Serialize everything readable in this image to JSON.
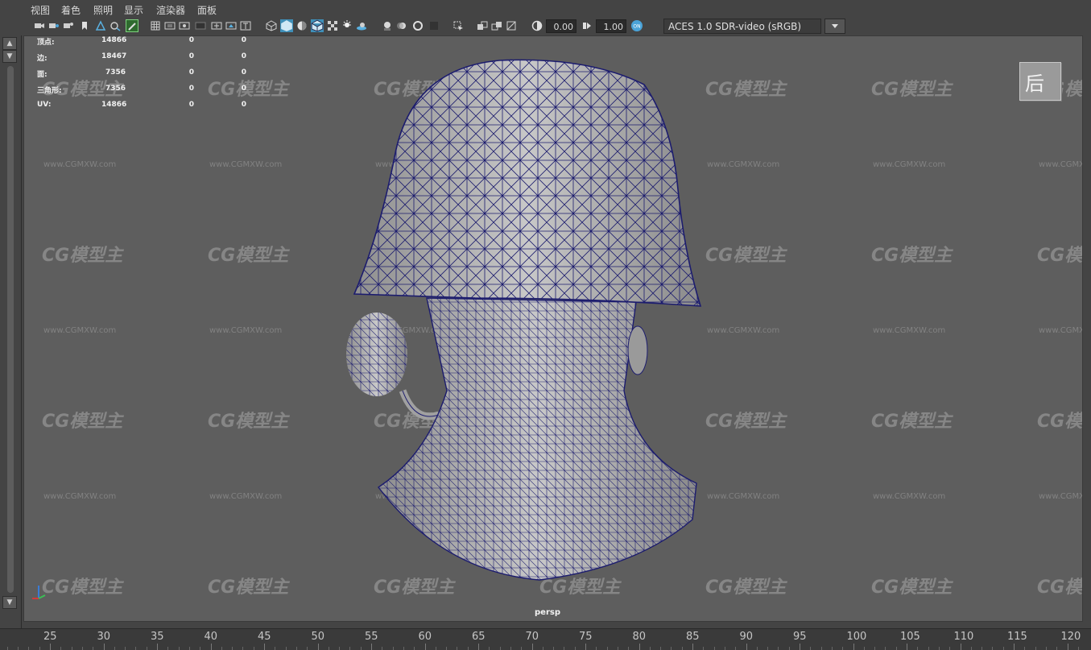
{
  "menu": [
    {
      "label": "视图"
    },
    {
      "label": "着色"
    },
    {
      "label": "照明"
    },
    {
      "label": "显示"
    },
    {
      "label": "渲染器"
    },
    {
      "label": "面板"
    }
  ],
  "toolbar": {
    "camera_near": "0.00",
    "camera_far": "1.00",
    "color_space": "ACES 1.0 SDR-video (sRGB)"
  },
  "hud": {
    "rows": [
      {
        "label": "顶点:",
        "v1": "14866",
        "v2": "0",
        "v3": "0"
      },
      {
        "label": "边:",
        "v1": "18467",
        "v2": "0",
        "v3": "0"
      },
      {
        "label": "面:",
        "v1": "7356",
        "v2": "0",
        "v3": "0"
      },
      {
        "label": "三角形:",
        "v1": "7356",
        "v2": "0",
        "v3": "0"
      },
      {
        "label": "UV:",
        "v1": "14866",
        "v2": "0",
        "v3": "0"
      }
    ]
  },
  "viewport": {
    "camera_label": "persp",
    "view_cube_label": "后",
    "watermark_logo": "CG模型主",
    "watermark_url": "www.CGMXW.com"
  },
  "timeline": {
    "ticks": [
      "25",
      "30",
      "35",
      "40",
      "45",
      "50",
      "55",
      "60",
      "65",
      "70",
      "75",
      "80",
      "85",
      "90",
      "95",
      "100",
      "105",
      "110",
      "115",
      "120"
    ]
  },
  "colors": {
    "viewport_bg": "#5e5e5e",
    "wire": "#1c1c6e",
    "mesh_fill": "#a8a8a8",
    "ui_bg": "#444444"
  }
}
